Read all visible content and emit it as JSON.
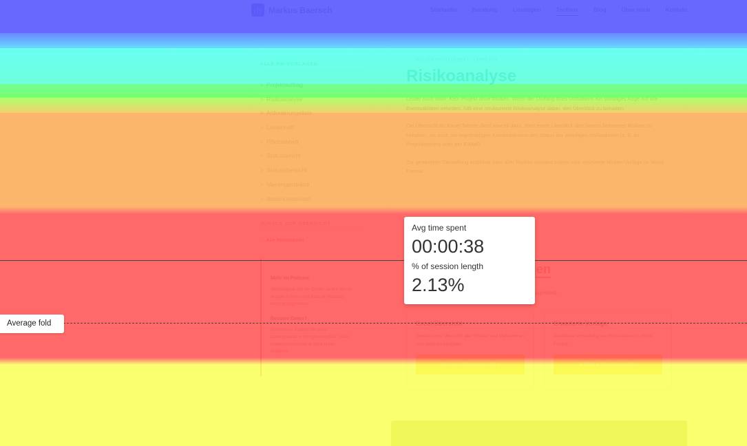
{
  "site": {
    "logo_text": "Markus Baersch",
    "nav": [
      "Startseite",
      "Beratung",
      "Lösungen",
      "Toolbox",
      "Blog",
      "Über mich",
      "Kontakt"
    ],
    "nav_active": "Toolbox"
  },
  "sidebar": {
    "heading": "ALLE PM-VORLAGEN",
    "items": [
      "Projektauftrag",
      "Risikoanalyse",
      "Anforderungsliste",
      "Lastenheft",
      "Pflichtenheft",
      "Statusbericht",
      "Statusübersicht",
      "Meetingprotokoll",
      "Abschlussbericht"
    ],
    "back_heading": "ZURÜCK ZUR ÜBERSICHT",
    "back_link": "← Alle Ressourcen",
    "podcast_title": "Mehr im Podcast",
    "podcast_text": "Webanalyse auf die Ohren: Jeden Monat Analytics News und Infos im Podcast",
    "podcast_link": "beyond pageviews",
    "data_title": "Bessere Daten?",
    "data_text": "Kostenlose Toolbox für mehr Datenqualität in Google Analytics: Audit, Datenschutzcheck & mehr unter",
    "data_link": "Analytrix"
  },
  "main": {
    "eyebrow": "// PROJEKTMANAGEMENT TEMPLATE",
    "title": "Risikoanalyse",
    "p1": "Leider auch wahr: Kein Projekt ohne Risiken. Wenn der Umfang Ihres Vorhabens ein ständiges Auge auf alle Eventualitäten erfordert, hilft eine strukturierte Risikoanalyse dabei, den Überblick zu behalten.",
    "p2": "Die Übersicht als Excel-Tabelle dient sowohl dazu, stets einen Überblick aller bereits bekannter Risiken zu behalten, als auch zur regelmäßigen Kommunikation des Status der jeweiligen Maßnahmen (z. B. im Projektmeeting oder per E-Mail).",
    "p3": "Zur genaueren Darstellung einzelner oder aller Risiken existiert zudem eine erweiterte Muster-Vorlage im Word-Format."
  },
  "download": {
    "title_fragment": "gen",
    "sub_fragment": "anagement.",
    "box1_title": "Excel-Übersicht",
    "box1_text": "Tabellarische Übersicht aller Risiken und Maßnahmen zum direkten Ausfüllen",
    "box1_button": "EXCEL VORLAGE (.ZIP)",
    "box2_title": "Erweiterte Vorlage",
    "box2_text": "Detaillierte Vorstellung von Einzelrisiken im Word-Format",
    "box2_button": "WORD VORLAGE (.ZIP)"
  },
  "overlay": {
    "fold_label": "Average fold",
    "tooltip_label1": "Avg time spent",
    "tooltip_value1": "00:00:38",
    "tooltip_label2": "% of session length",
    "tooltip_value2": "2.13%"
  }
}
